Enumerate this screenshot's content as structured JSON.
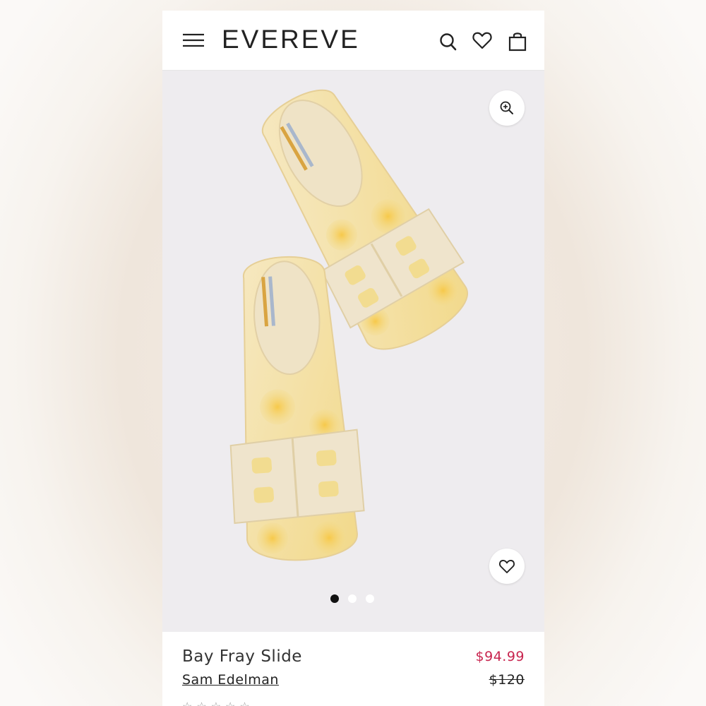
{
  "header": {
    "logo": "EVEREVE",
    "icons": [
      "menu-icon",
      "search-icon",
      "heart-icon",
      "bag-icon"
    ]
  },
  "gallery": {
    "zoom_icon": "zoom-in-icon",
    "favorite_icon": "heart-icon",
    "dots_count": 3,
    "active_dot": 1,
    "background": "#eeecef"
  },
  "product": {
    "name": "Bay Fray Slide",
    "brand": "Sam Edelman",
    "sale_price": "$94.99",
    "original_price": "$120",
    "rating_stars": "☆☆☆☆☆"
  },
  "colors": {
    "sale": "#c8254f",
    "text": "#222222"
  }
}
